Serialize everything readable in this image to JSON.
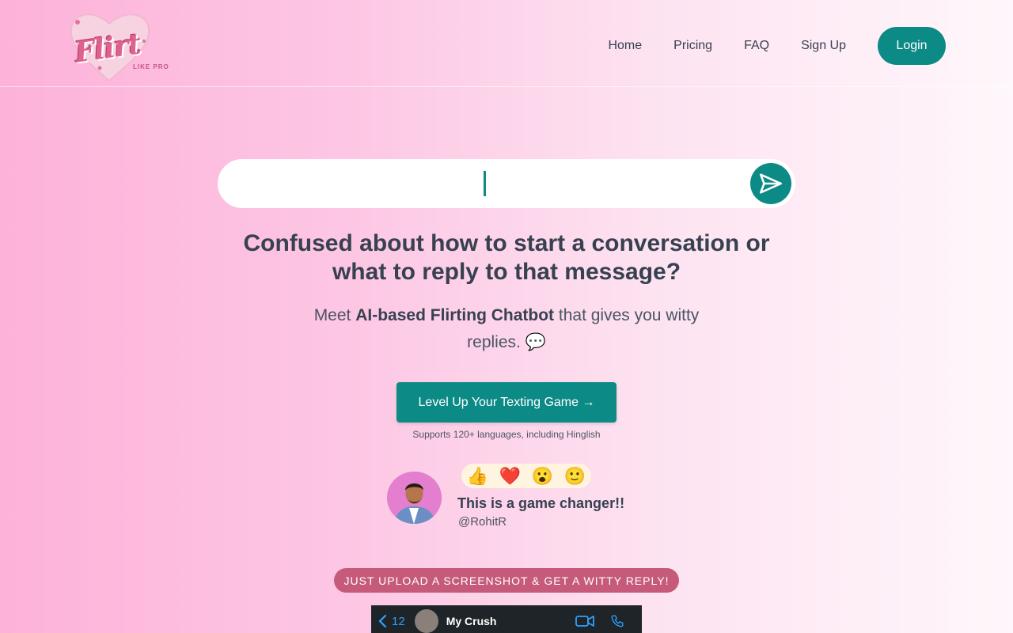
{
  "brand": {
    "logo_text": "Flirt",
    "logo_sub": "LIKE PRO"
  },
  "nav": {
    "items": [
      {
        "label": "Home"
      },
      {
        "label": "Pricing"
      },
      {
        "label": "FAQ"
      },
      {
        "label": "Sign Up"
      }
    ],
    "login_label": "Login"
  },
  "chat": {
    "input_value": "",
    "send_icon": "send-icon"
  },
  "hero": {
    "headline_line1": "Confused about how to start a conversation or",
    "headline_line2": "what to reply to that message?",
    "sub_prefix": "Meet ",
    "sub_bold": "AI-based Flirting Chatbot",
    "sub_suffix": " that gives you witty replies.",
    "sub_emoji": "💬",
    "cta_label": "Level Up Your Texting Game →",
    "supports": "Supports 120+ languages, including Hinglish"
  },
  "testimonial": {
    "reactions": [
      "👍",
      "❤️",
      "😮",
      "🙂"
    ],
    "quote": "This is a game changer!!",
    "handle": "@RohitR"
  },
  "upload": {
    "label": "JUST UPLOAD A SCREENSHOT & GET A WITTY REPLY!"
  },
  "phone_preview": {
    "back_count": "12",
    "contact_name": "My Crush"
  },
  "colors": {
    "accent": "#0c8a86",
    "badge": "#c65a7b",
    "text": "#374151"
  }
}
